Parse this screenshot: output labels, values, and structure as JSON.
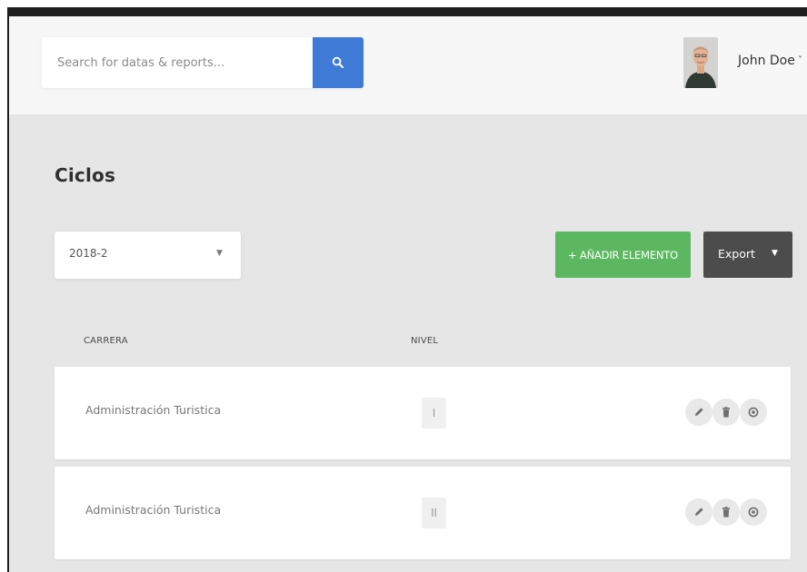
{
  "search": {
    "placeholder": "Search for datas & reports...",
    "button_icon": "search-icon"
  },
  "user": {
    "name": "John Doe",
    "caret": "˅",
    "avatar_icon": "avatar"
  },
  "page": {
    "title": "Ciclos"
  },
  "filter": {
    "selected": "2018-2",
    "caret": "▼"
  },
  "toolbar": {
    "add_label": "+ AÑADIR ELEMENTO",
    "export_label": "Export",
    "export_caret": "▼"
  },
  "table": {
    "columns": [
      "CARRERA",
      "NIVEL"
    ],
    "rows": [
      {
        "carrera": "Administración Turistica",
        "nivel": "I"
      },
      {
        "carrera": "Administración Turistica",
        "nivel": "II"
      }
    ],
    "row_actions": [
      "edit-icon",
      "trash-icon",
      "view-icon"
    ]
  },
  "colors": {
    "search_button": "#3f7ad6",
    "add_button": "#5cb860",
    "export_button": "#4c4c4c",
    "page_background": "#e6e6e6"
  }
}
